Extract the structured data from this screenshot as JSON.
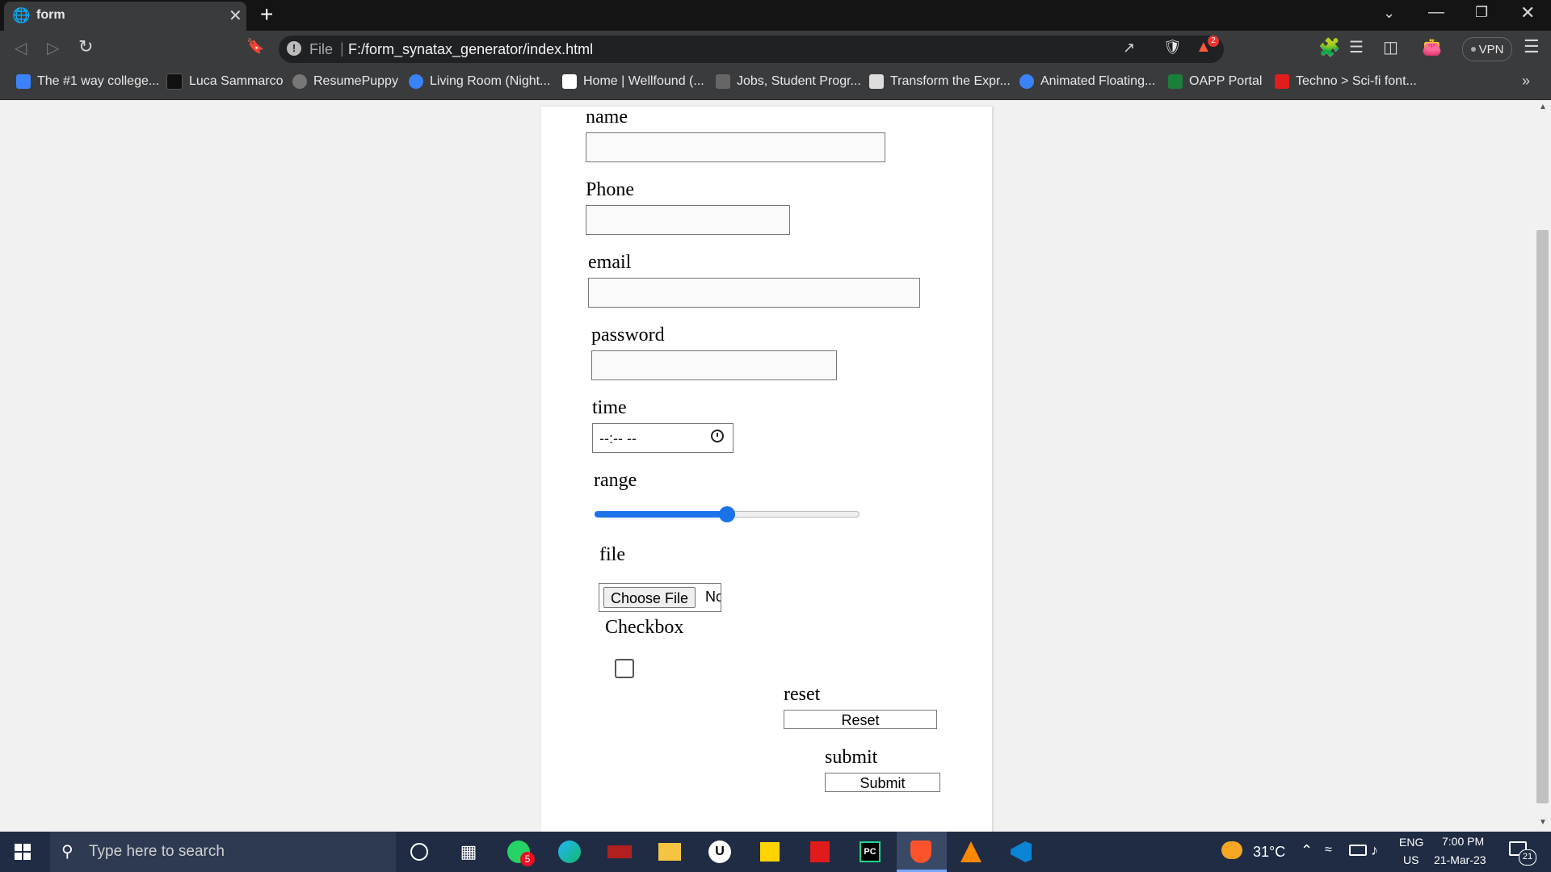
{
  "browser": {
    "tab_title": "form",
    "new_tab_icon": "plus-icon",
    "address_prefix": "File",
    "url": "F:/form_synatax_generator/index.html",
    "vpn_label": "VPN",
    "notification_count": "2",
    "bookmarks": [
      {
        "label": "The #1 way college...",
        "icon": "bookmark-favicon",
        "color": "#3b82f6"
      },
      {
        "label": "Luca Sammarco",
        "icon": "bookmark-favicon",
        "color": "#111111"
      },
      {
        "label": "ResumePuppy",
        "icon": "globe-icon",
        "color": "#777777"
      },
      {
        "label": "Living Room (Night...",
        "icon": "bookmark-favicon",
        "color": "#3b82f6"
      },
      {
        "label": "Home | Wellfound (...",
        "icon": "bookmark-favicon",
        "color": "#ffffff"
      },
      {
        "label": "Jobs, Student Progr...",
        "icon": "bookmark-favicon",
        "color": "#666666"
      },
      {
        "label": "Transform the Expr...",
        "icon": "bookmark-favicon",
        "color": "#dddddd"
      },
      {
        "label": "Animated Floating...",
        "icon": "bookmark-favicon",
        "color": "#3b82f6"
      },
      {
        "label": "OAPP Portal",
        "icon": "bookmark-favicon",
        "color": "#1a7f3a"
      },
      {
        "label": "Techno > Sci-fi font...",
        "icon": "bookmark-favicon",
        "color": "#e11d1d"
      }
    ]
  },
  "form": {
    "name_label": "name",
    "phone_label": "Phone",
    "email_label": "email",
    "password_label": "password",
    "time_label": "time",
    "time_placeholder": "--:-- --",
    "range_label": "range",
    "range_value_fraction": 0.5,
    "file_label": "file",
    "choose_file_label": "Choose File",
    "no_file_text": "Nc",
    "checkbox_label": "Checkbox",
    "reset_label": "reset",
    "reset_button": "Reset",
    "submit_label": "submit",
    "submit_button": "Submit"
  },
  "taskbar": {
    "search_placeholder": "Type here to search",
    "whatsapp_badge": "5",
    "temperature": "31°C",
    "language": "ENG",
    "region": "US",
    "time": "7:00 PM",
    "date": "21-Mar-23",
    "notification_count": "21"
  },
  "colors": {
    "accent": "#1a73e8",
    "chrome_dark": "#3a3b3d",
    "taskbar": "#1f2c44"
  }
}
